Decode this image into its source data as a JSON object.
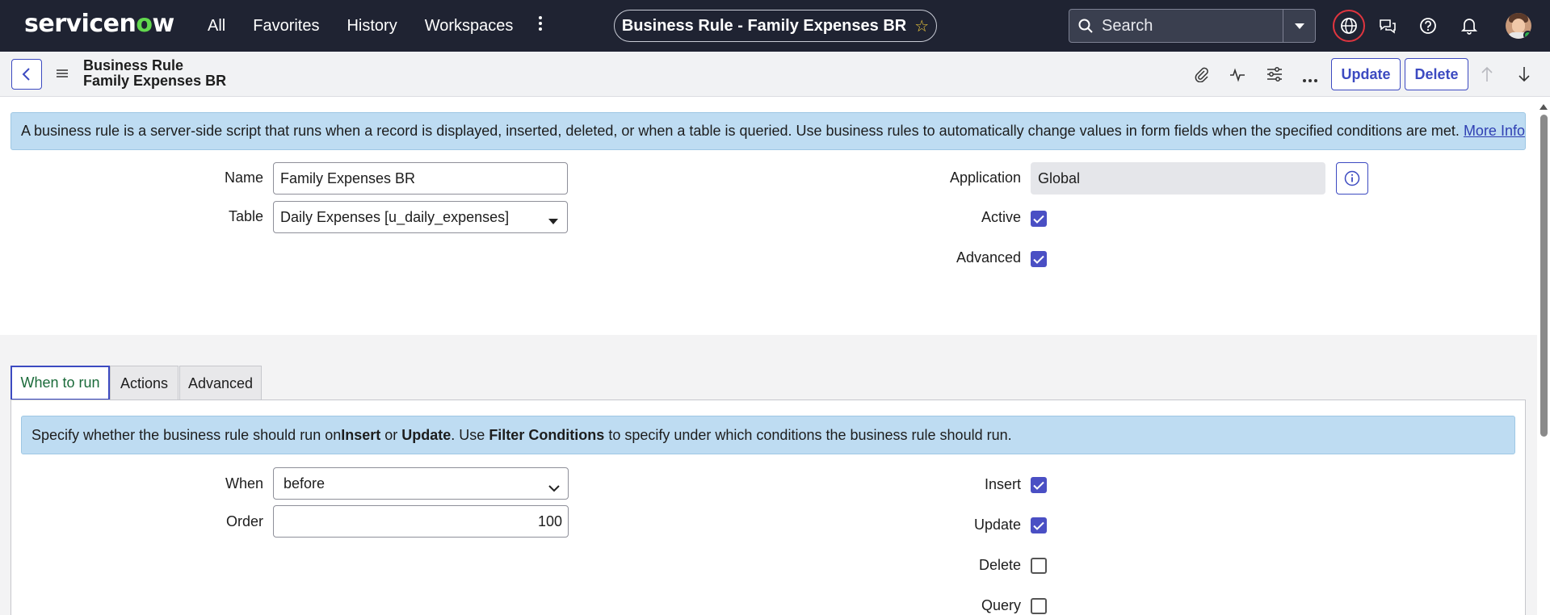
{
  "topnav": {
    "logo_prefix": "servicen",
    "logo_o": "o",
    "logo_suffix": "w",
    "links": [
      "All",
      "Favorites",
      "History",
      "Workspaces"
    ],
    "more_icon": "vertical-dots-icon",
    "record_pill": "Business Rule - Family Expenses BR",
    "search_placeholder": "Search"
  },
  "form_header": {
    "line1": "Business Rule",
    "line2": "Family Expenses BR",
    "update_label": "Update",
    "delete_label": "Delete"
  },
  "info_banner": {
    "text": "A business rule is a server-side script that runs when a record is displayed, inserted, deleted, or when a table is queried. Use business rules to automatically change values in form fields when the specified conditions are met.",
    "link": "More Info"
  },
  "fields": {
    "name_label": "Name",
    "name_value": "Family Expenses BR",
    "table_label": "Table",
    "table_value": "Daily Expenses [u_daily_expenses]",
    "application_label": "Application",
    "application_value": "Global",
    "active_label": "Active",
    "active_checked": true,
    "advanced_label": "Advanced",
    "advanced_checked": true
  },
  "tabs": [
    "When to run",
    "Actions",
    "Advanced"
  ],
  "when_to_run": {
    "banner_pre": "Specify whether the business rule should run on ",
    "banner_insert": "Insert",
    "banner_or": " or ",
    "banner_update": "Update",
    "banner_mid": ". Use ",
    "banner_filter": "Filter Conditions",
    "banner_post": " to specify under which conditions the business rule should run.",
    "when_label": "When",
    "when_value": "before",
    "order_label": "Order",
    "order_value": "100",
    "insert_label": "Insert",
    "insert_checked": true,
    "update_label": "Update",
    "update_checked": true,
    "delete_label": "Delete",
    "delete_checked": false,
    "query_label": "Query",
    "query_checked": false
  },
  "colors": {
    "nav_bg": "#1f2332",
    "accent": "#3c4ac1",
    "banner_bg": "#bedcf2",
    "logo_green": "#62d84e"
  }
}
